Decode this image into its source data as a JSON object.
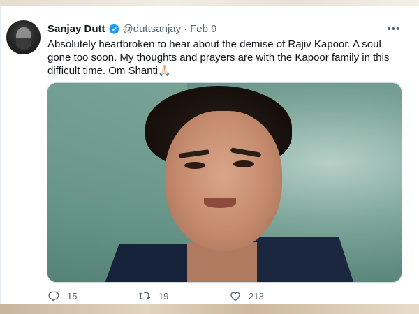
{
  "tweet": {
    "author": {
      "name": "Sanjay Dutt",
      "handle": "@duttsanjay",
      "verified": true
    },
    "separator": "·",
    "date": "Feb 9",
    "text": "Absolutely heartbroken to hear about the demise of Rajiv Kapoor. A soul gone too soon. My thoughts and prayers are with the Kapoor family in this difficult time. Om Shanti🙏🏻",
    "more_label": "•••",
    "actions": {
      "replies": "15",
      "retweets": "19",
      "likes": "213"
    }
  },
  "colors": {
    "text": "#0f1419",
    "secondary": "#536471",
    "verified": "#1d9bf0"
  },
  "icons": [
    "verified-badge-icon",
    "more-icon",
    "reply-icon",
    "retweet-icon",
    "like-icon"
  ]
}
